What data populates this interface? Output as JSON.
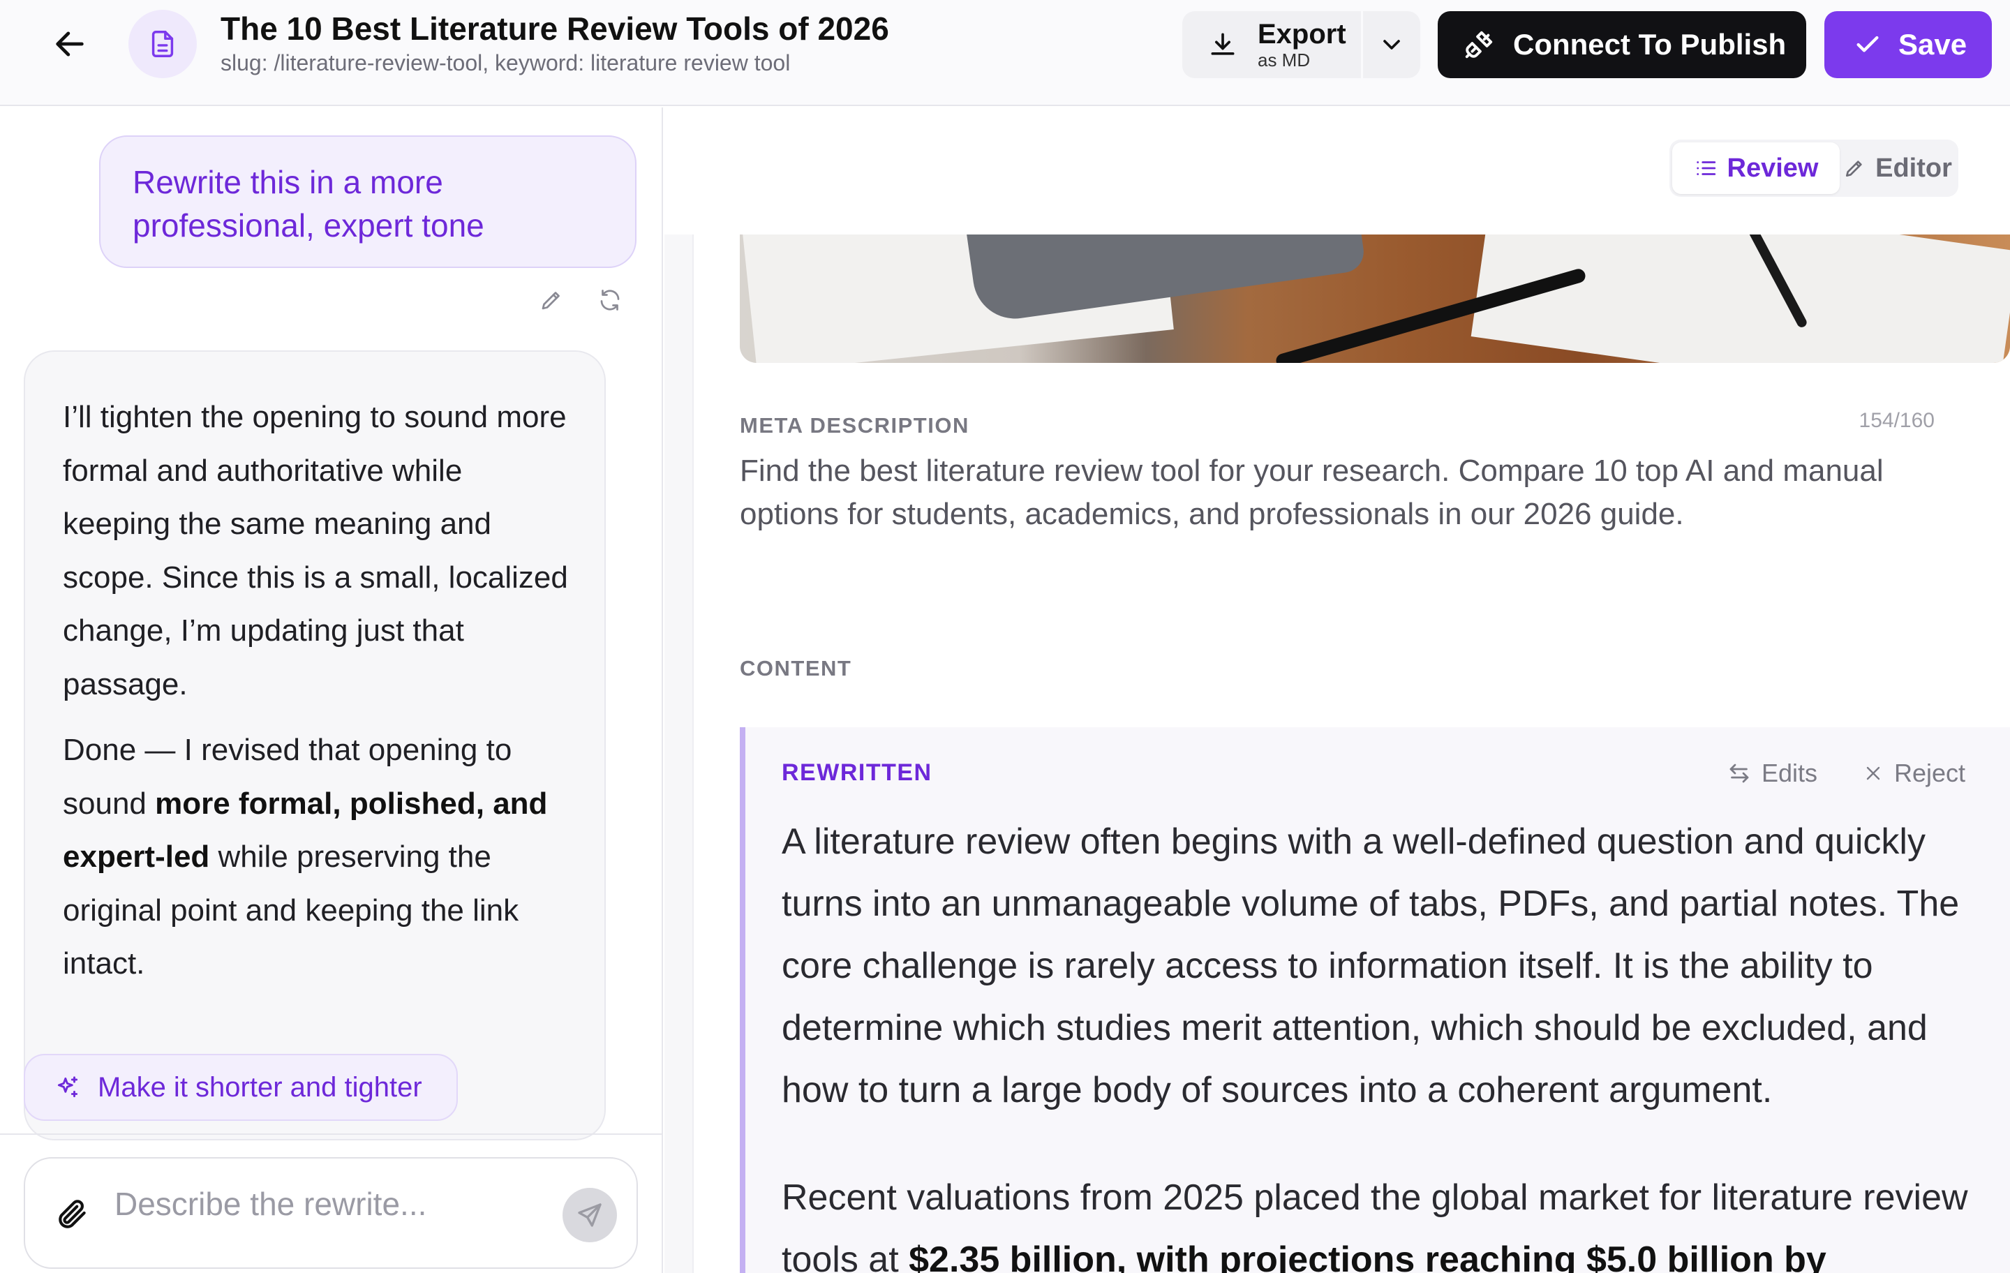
{
  "header": {
    "title": "The 10 Best Literature Review Tools of 2026",
    "subtitle": "slug: /literature-review-tool, keyword: literature review tool",
    "export_label": "Export",
    "export_sub": "as MD",
    "publish_label": "Connect To Publish",
    "save_label": "Save"
  },
  "chat": {
    "user_message": "Rewrite this in a more professional, expert tone",
    "assistant": {
      "p1": "I’ll tighten the opening to sound more formal and authoritative while keeping the same meaning and scope. Since this is a small, localized change, I’m updating just that passage.",
      "p2_before": "Done — I revised that opening to sound ",
      "p2_bold": "more formal, polished, and expert-led",
      "p2_after": " while preserving the original point and keeping the link intact."
    },
    "suggestion": "Make it shorter and tighter",
    "input_placeholder": "Describe the rewrite..."
  },
  "view_toggle": {
    "review_label": "Review",
    "editor_label": "Editor",
    "active": "Review"
  },
  "meta": {
    "label": "META DESCRIPTION",
    "count": "154/160",
    "text": "Find the best literature review tool for your research. Compare 10 top AI and manual options for students, academics, and professionals in our 2026 guide."
  },
  "content": {
    "label": "CONTENT",
    "rewritten_label": "REWRITTEN",
    "edits_label": "Edits",
    "reject_label": "Reject",
    "p1": "A literature review often begins with a well-defined question and quickly turns into an unmanageable volume of tabs, PDFs, and partial notes. The core challenge is rarely access to information itself. It is the ability to determine which studies merit attention, which should be excluded, and how to turn a large body of sources into a coherent argument.",
    "p2_before": "Recent valuations from 2025 placed the global market for literature review tools at ",
    "p2_link": "$2.35 billion, with projections reaching $5.0 billion by"
  },
  "colors": {
    "accent": "#7c3aed",
    "accent_text": "#6d28d9",
    "publish_bg": "#111114"
  }
}
